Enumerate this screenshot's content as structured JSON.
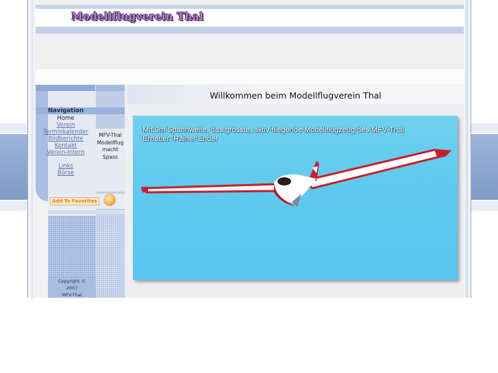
{
  "site": {
    "logo_text": "Modellflugverein Thal"
  },
  "navigation": {
    "title": "Navigation",
    "items": [
      {
        "label": "Home",
        "link": false
      },
      {
        "label": "Verein",
        "link": true
      },
      {
        "label": "Terminkalender",
        "link": true
      },
      {
        "label": "Bildberichte",
        "link": true
      },
      {
        "label": "Kontakt",
        "link": true
      },
      {
        "label": "Verein-Intern",
        "link": true
      },
      {
        "label": "Links",
        "link": true
      },
      {
        "label": "Börse",
        "link": true
      }
    ]
  },
  "slogan": [
    "MFV-Thal",
    "Modellflug",
    "macht",
    "Spass"
  ],
  "favorites": {
    "label": "Add To Favorites"
  },
  "copyright": [
    "Copyright ©",
    "2007",
    "MFV-Thal"
  ],
  "main": {
    "title": "Willkommen beim Modellflugverein Thal",
    "photo_caption_line1": "Mit 9m Spannweite, das grösste, aktiv fliegende Modellflugzeug des MFV-Thal",
    "photo_caption_line2": "Erbauer: Rainer Ender"
  },
  "colors": {
    "accent_blue": "#8eaad6",
    "sky": "#5ec9ee",
    "link": "#5a6fa8"
  }
}
